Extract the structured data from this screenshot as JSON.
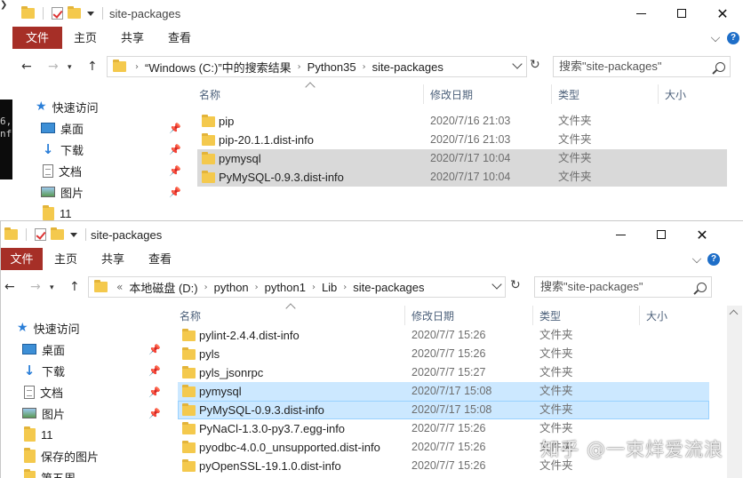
{
  "console": {
    "lines": [
      "6,",
      "nf"
    ]
  },
  "window_back": {
    "title": "site-packages",
    "ribbon_tabs": [
      "文件",
      "主页",
      "共享",
      "查看"
    ],
    "address_crumbs": [
      "“Windows (C:)”中的搜索结果",
      "Python35",
      "site-packages"
    ],
    "search_placeholder": "搜索\"site-packages\"",
    "sidebar": [
      {
        "label": "快速访问",
        "icon": "star-icon"
      },
      {
        "label": "桌面",
        "icon": "desktop-icon"
      },
      {
        "label": "下载",
        "icon": "download-icon"
      },
      {
        "label": "文档",
        "icon": "document-icon"
      },
      {
        "label": "图片",
        "icon": "picture-icon"
      },
      {
        "label": "11",
        "icon": "folder-icon"
      }
    ],
    "columns": [
      "名称",
      "修改日期",
      "类型",
      "大小"
    ],
    "rows": [
      {
        "name": "pip",
        "date": "2020/7/16 21:03",
        "type": "文件夹",
        "state": "normal"
      },
      {
        "name": "pip-20.1.1.dist-info",
        "date": "2020/7/16 21:03",
        "type": "文件夹",
        "state": "normal"
      },
      {
        "name": "pymysql",
        "date": "2020/7/17 10:04",
        "type": "文件夹",
        "state": "selected"
      },
      {
        "name": "PyMySQL-0.9.3.dist-info",
        "date": "2020/7/17 10:04",
        "type": "文件夹",
        "state": "selected"
      }
    ]
  },
  "window_front": {
    "title": "site-packages",
    "ribbon_tabs": [
      "文件",
      "主页",
      "共享",
      "查看"
    ],
    "address_prefix": "«",
    "address_crumbs": [
      "本地磁盘 (D:)",
      "python",
      "python1",
      "Lib",
      "site-packages"
    ],
    "search_placeholder": "搜索\"site-packages\"",
    "sidebar": [
      {
        "label": "快速访问",
        "icon": "star-icon"
      },
      {
        "label": "桌面",
        "icon": "desktop-icon"
      },
      {
        "label": "下载",
        "icon": "download-icon"
      },
      {
        "label": "文档",
        "icon": "document-icon"
      },
      {
        "label": "图片",
        "icon": "picture-icon"
      },
      {
        "label": "11",
        "icon": "folder-icon"
      },
      {
        "label": "保存的图片",
        "icon": "folder-icon"
      },
      {
        "label": "第五周",
        "icon": "folder-icon"
      }
    ],
    "columns": [
      "名称",
      "修改日期",
      "类型",
      "大小"
    ],
    "rows": [
      {
        "name": "pylint-2.4.4.dist-info",
        "date": "2020/7/7 15:26",
        "type": "文件夹",
        "state": "normal"
      },
      {
        "name": "pyls",
        "date": "2020/7/7 15:26",
        "type": "文件夹",
        "state": "normal"
      },
      {
        "name": "pyls_jsonrpc",
        "date": "2020/7/7 15:27",
        "type": "文件夹",
        "state": "normal"
      },
      {
        "name": "pymysql",
        "date": "2020/7/17 15:08",
        "type": "文件夹",
        "state": "selected"
      },
      {
        "name": "PyMySQL-0.9.3.dist-info",
        "date": "2020/7/17 15:08",
        "type": "文件夹",
        "state": "focused"
      },
      {
        "name": "PyNaCl-1.3.0-py3.7.egg-info",
        "date": "2020/7/7 15:26",
        "type": "文件夹",
        "state": "normal"
      },
      {
        "name": "pyodbc-4.0.0_unsupported.dist-info",
        "date": "2020/7/7 15:26",
        "type": "文件夹",
        "state": "normal"
      },
      {
        "name": "pyOpenSSL-19.1.0.dist-info",
        "date": "2020/7/7 15:26",
        "type": "文件夹",
        "state": "normal"
      }
    ]
  },
  "watermark": "知乎 @一束烊爱流浪"
}
